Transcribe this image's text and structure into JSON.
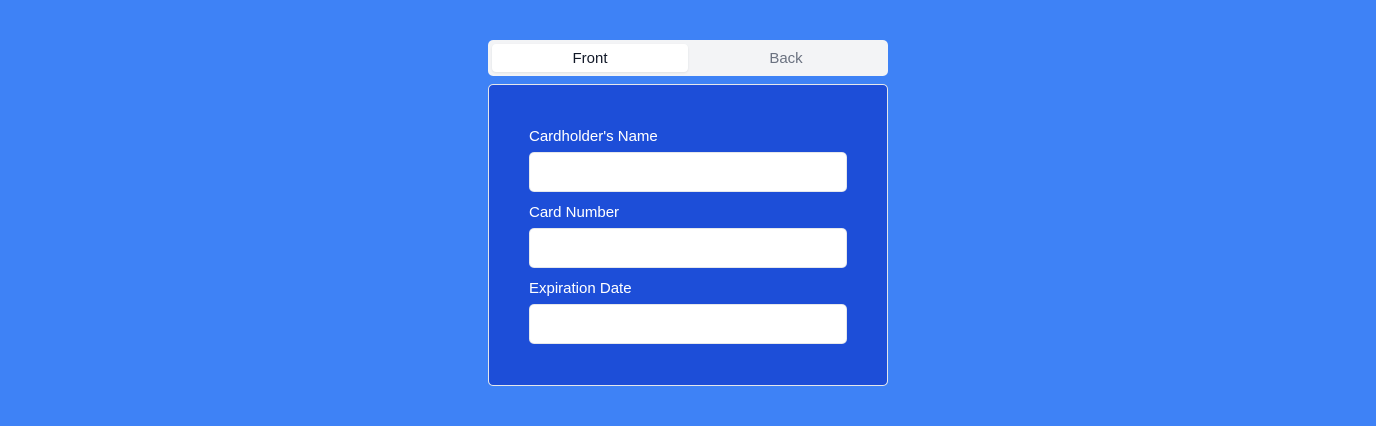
{
  "tabs": [
    {
      "label": "Front",
      "active": true
    },
    {
      "label": "Back",
      "active": false
    }
  ],
  "form": {
    "cardholder_label": "Cardholder's Name",
    "cardholder_value": "",
    "card_number_label": "Card Number",
    "card_number_value": "",
    "expiration_label": "Expiration Date",
    "expiration_value": ""
  },
  "colors": {
    "page_background": "#3e82f6",
    "card_background": "#1d4ed8",
    "tab_bar_background": "#f3f4f6",
    "active_tab_background": "#ffffff"
  }
}
